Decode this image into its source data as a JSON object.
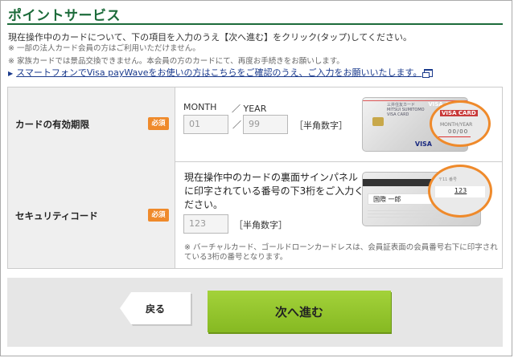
{
  "header": {
    "title": "ポイントサービス"
  },
  "intro": {
    "lead": "現在操作中のカードについて、下の項目を入力のうえ【次へ進む】をクリック(タップ)してください。",
    "note1": "※ 一部の法人カード会員の方はご利用いただけません。",
    "note2": "※ 家族カードでは景品交換できません。本会員の方のカードにて、再度お手続きをお願いします。",
    "link": "スマートフォンでVisa payWaveをお使いの方はこちらをご確認のうえ、ご入力をお願いいたします。"
  },
  "expiry": {
    "label": "カードの有効期限",
    "required_badge": "必須",
    "month_label": "MONTH",
    "year_label": "／ YEAR",
    "month_value": "01",
    "slash": "／",
    "year_value": "99",
    "hint": "［半角数字］",
    "card_brand": "VISA CARD",
    "card_bank": "三井住友カード\nMITSUI SUMITOMO\nVISA CARD",
    "card_network": "VISA",
    "mag_text": "VISA CARD",
    "mag_sub": "MONTH/YEAR",
    "mag_digits": "00/00"
  },
  "security": {
    "label": "セキュリティコード",
    "required_badge": "必須",
    "description": "現在操作中のカードの裏面サインパネルに印字されている番号の下3桁をご入力ください。",
    "value": "123",
    "hint": "［半角数字］",
    "note": "※ バーチャルカード、ゴールドローンカードレスは、会員証表面の会員番号右下に印字されている3桁の番号となります。",
    "card_signature": "国際 一郎",
    "mag_number": "123",
    "mag_small": "〒11 番号"
  },
  "actions": {
    "back_label": "戻る",
    "next_label": "次へ進む"
  },
  "colors": {
    "title_green": "#1c6b3a",
    "badge_orange": "#ef8a2b",
    "next_green": "#a3d23a",
    "link_blue": "#1a3a8c"
  }
}
